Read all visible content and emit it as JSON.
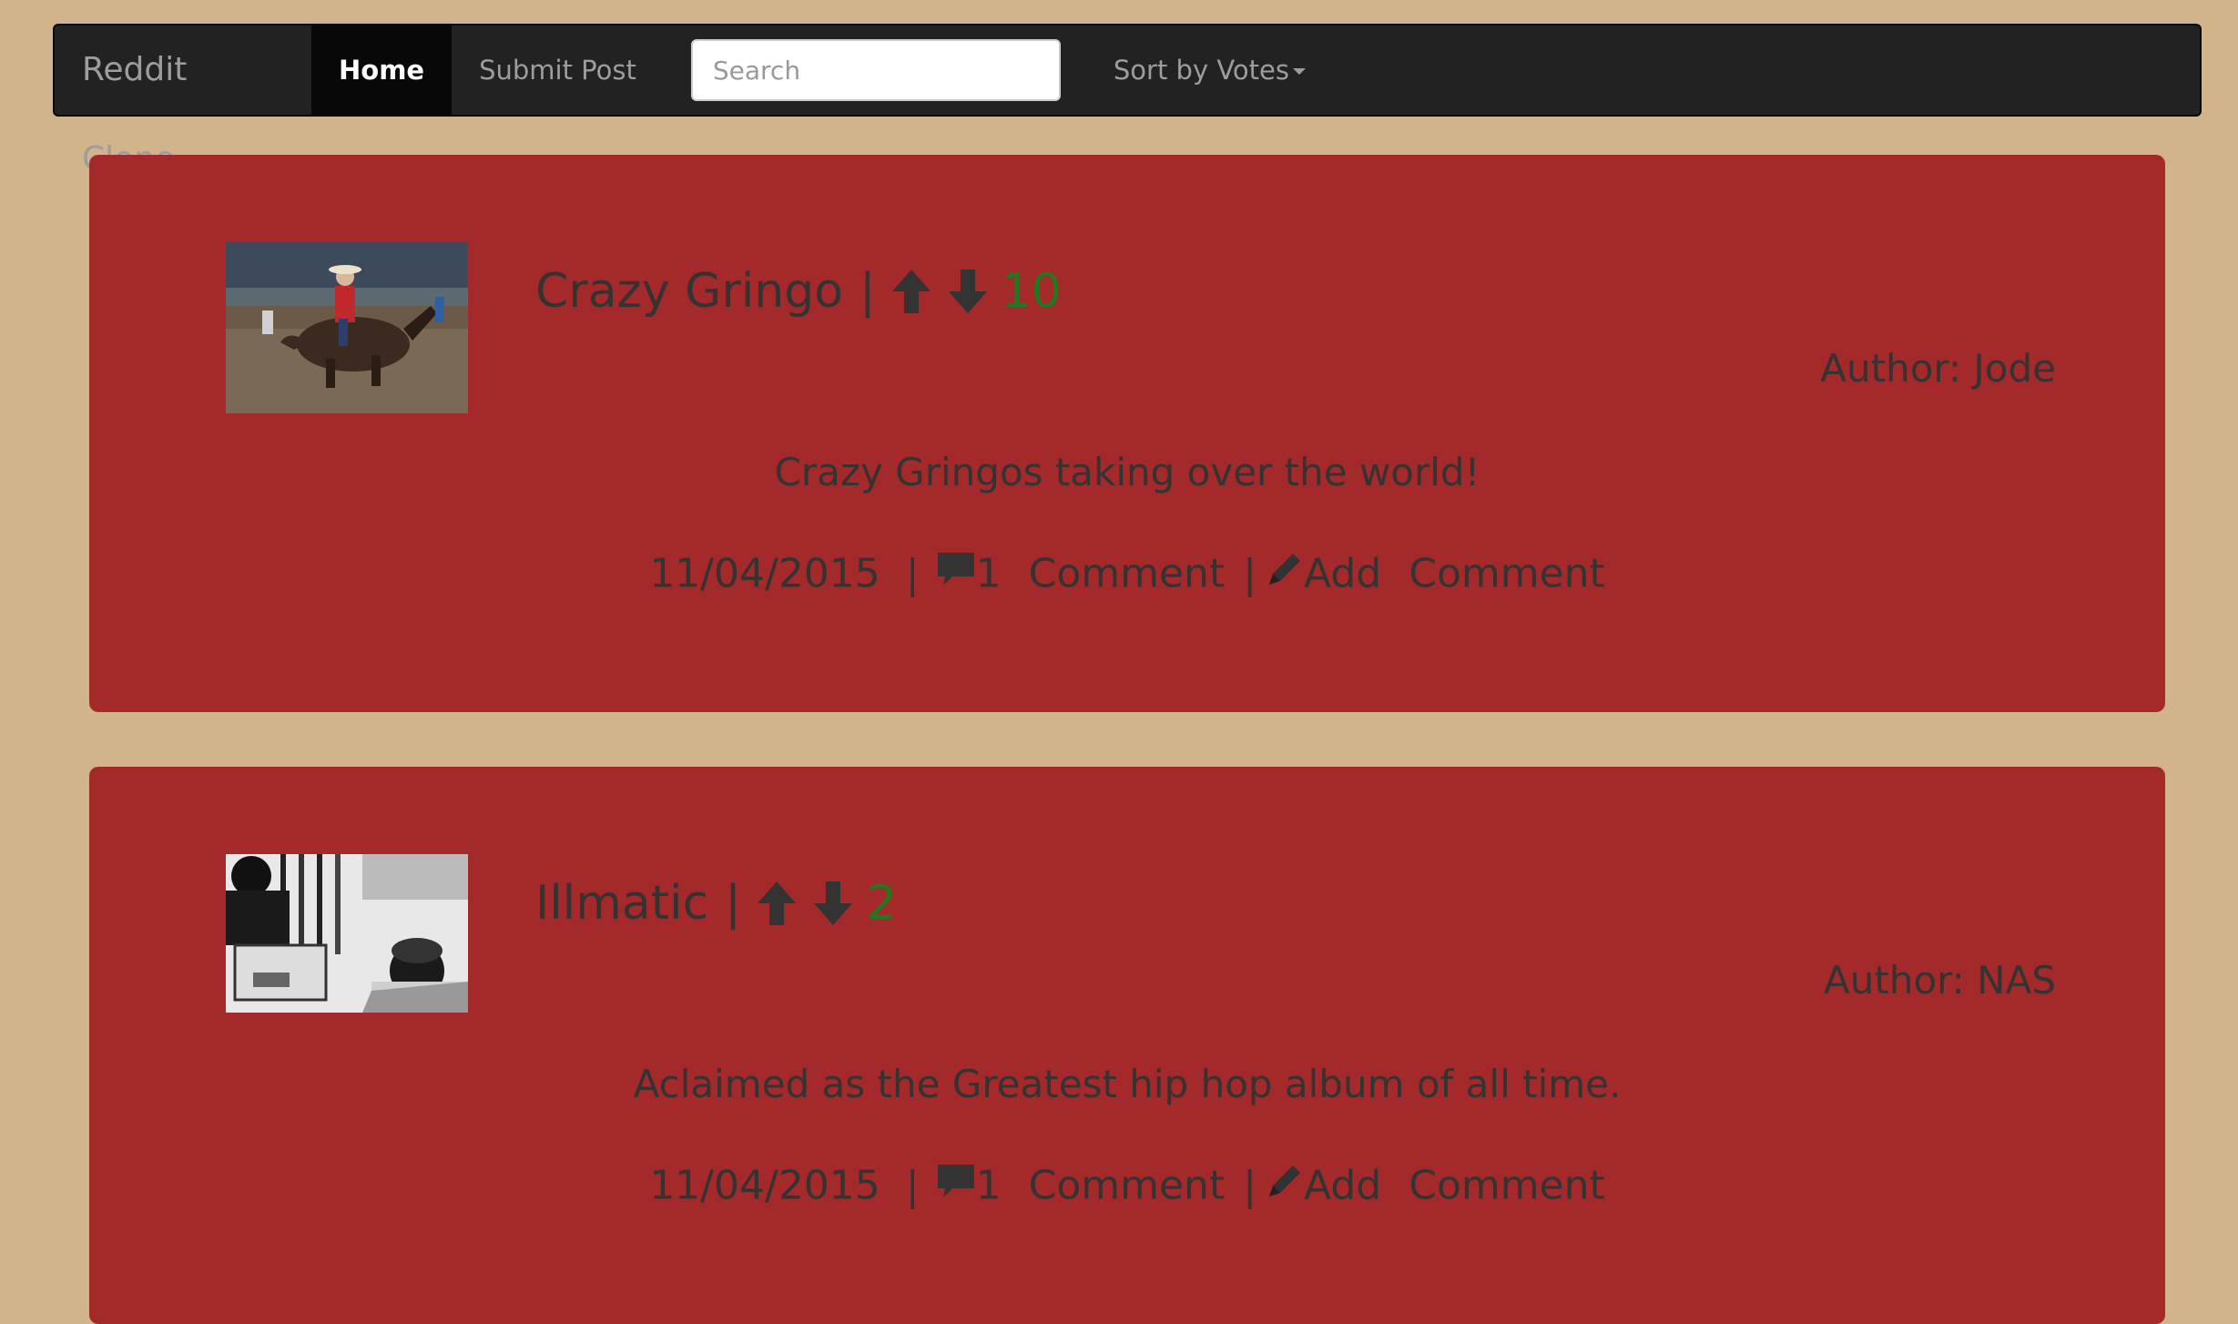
{
  "navbar": {
    "brand": "Reddit Clone",
    "home_label": "Home",
    "submit_label": "Submit Post",
    "search_placeholder": "Search",
    "sort_label": "Sort by Votes"
  },
  "colors": {
    "page_bg": "#d2b48c",
    "navbar_bg": "#222222",
    "post_bg": "#a4292b",
    "vote_count": "#1f7a1f"
  },
  "posts": [
    {
      "title": "Crazy Gringo",
      "separator": "|",
      "votes": "10",
      "author": "Author: Jode",
      "body": "Crazy Gringos taking over the world!",
      "date": "11/04/2015",
      "meta_sep": "|",
      "comment_count": "1",
      "comment_word": "Comment",
      "add_word": "Add",
      "add_comment_word": "Comment",
      "thumbnail": "bull-rider-photo"
    },
    {
      "title": "Illmatic",
      "separator": "|",
      "votes": "2",
      "author": "Author: NAS",
      "body": "Aclaimed as the Greatest hip hop album of all time.",
      "date": "11/04/2015",
      "meta_sep": "|",
      "comment_count": "1",
      "comment_word": "Comment",
      "add_word": "Add",
      "add_comment_word": "Comment",
      "thumbnail": "bw-studio-photo"
    }
  ]
}
